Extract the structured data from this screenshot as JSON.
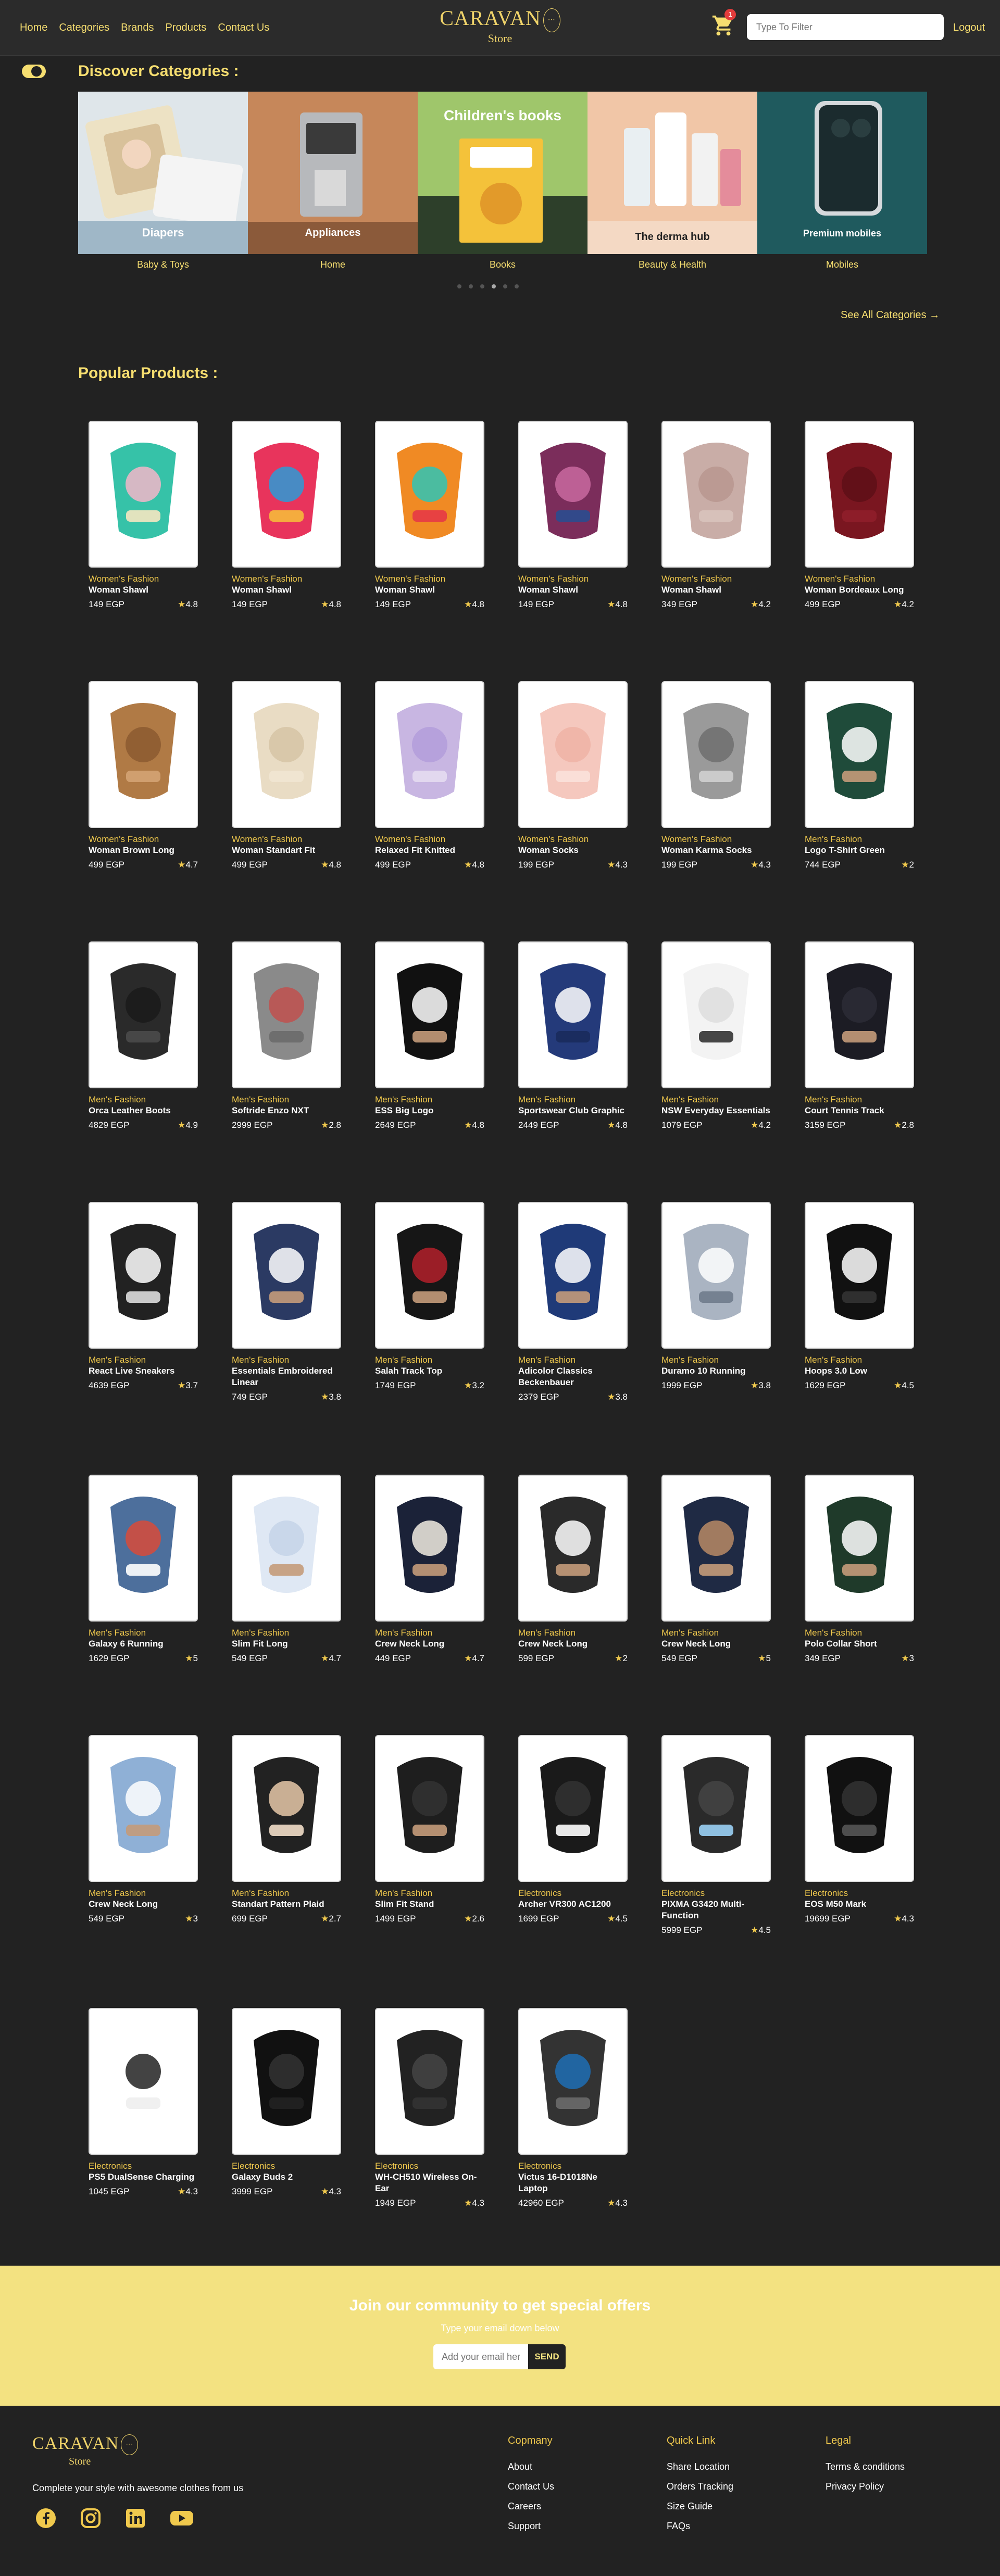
{
  "nav": {
    "links": [
      "Home",
      "Categories",
      "Brands",
      "Products",
      "Contact Us"
    ],
    "logo_word": "CARAVAN",
    "logo_sub": "Store",
    "cart_count": "1",
    "search_placeholder": "Type To Filter",
    "logout": "Logout"
  },
  "categories": {
    "title": "Discover Categories :",
    "items": [
      {
        "label": "Baby & Toys",
        "caption": "Diapers"
      },
      {
        "label": "Home",
        "caption": "Appliances"
      },
      {
        "label": "Books",
        "caption": "Children's books"
      },
      {
        "label": "Beauty & Health",
        "caption": "The derma hub"
      },
      {
        "label": "Mobiles",
        "caption": "Premium mobiles"
      }
    ],
    "see_all": "See All Categories →"
  },
  "products": {
    "title": "Popular Products :",
    "items": [
      {
        "category": "Women's Fashion",
        "name": "Woman Shawl",
        "price": "149 EGP",
        "rating": "4.8"
      },
      {
        "category": "Women's Fashion",
        "name": "Woman Shawl",
        "price": "149 EGP",
        "rating": "4.8"
      },
      {
        "category": "Women's Fashion",
        "name": "Woman Shawl",
        "price": "149 EGP",
        "rating": "4.8"
      },
      {
        "category": "Women's Fashion",
        "name": "Woman Shawl",
        "price": "149 EGP",
        "rating": "4.8"
      },
      {
        "category": "Women's Fashion",
        "name": "Woman Shawl",
        "price": "349 EGP",
        "rating": "4.2"
      },
      {
        "category": "Women's Fashion",
        "name": "Woman Bordeaux Long",
        "price": "499 EGP",
        "rating": "4.2"
      },
      {
        "category": "Women's Fashion",
        "name": "Woman Brown Long",
        "price": "499 EGP",
        "rating": "4.7"
      },
      {
        "category": "Women's Fashion",
        "name": "Woman Standart Fit",
        "price": "499 EGP",
        "rating": "4.8"
      },
      {
        "category": "Women's Fashion",
        "name": "Relaxed Fit Knitted",
        "price": "499 EGP",
        "rating": "4.8"
      },
      {
        "category": "Women's Fashion",
        "name": "Woman Socks",
        "price": "199 EGP",
        "rating": "4.3"
      },
      {
        "category": "Women's Fashion",
        "name": "Woman Karma Socks",
        "price": "199 EGP",
        "rating": "4.3"
      },
      {
        "category": "Men's Fashion",
        "name": "Logo T-Shirt Green",
        "price": "744 EGP",
        "rating": "2"
      },
      {
        "category": "Men's Fashion",
        "name": "Orca Leather Boots",
        "price": "4829 EGP",
        "rating": "4.9"
      },
      {
        "category": "Men's Fashion",
        "name": "Softride Enzo NXT",
        "price": "2999 EGP",
        "rating": "2.8"
      },
      {
        "category": "Men's Fashion",
        "name": "ESS Big Logo",
        "price": "2649 EGP",
        "rating": "4.8"
      },
      {
        "category": "Men's Fashion",
        "name": "Sportswear Club Graphic",
        "price": "2449 EGP",
        "rating": "4.8"
      },
      {
        "category": "Men's Fashion",
        "name": "NSW Everyday Essentials",
        "price": "1079 EGP",
        "rating": "4.2"
      },
      {
        "category": "Men's Fashion",
        "name": "Court Tennis Track",
        "price": "3159 EGP",
        "rating": "2.8"
      },
      {
        "category": "Men's Fashion",
        "name": "React Live Sneakers",
        "price": "4639 EGP",
        "rating": "3.7"
      },
      {
        "category": "Men's Fashion",
        "name": "Essentials Embroidered Linear",
        "price": "749 EGP",
        "rating": "3.8"
      },
      {
        "category": "Men's Fashion",
        "name": "Salah Track Top",
        "price": "1749 EGP",
        "rating": "3.2"
      },
      {
        "category": "Men's Fashion",
        "name": "Adicolor Classics Beckenbauer",
        "price": "2379 EGP",
        "rating": "3.8"
      },
      {
        "category": "Men's Fashion",
        "name": "Duramo 10 Running",
        "price": "1999 EGP",
        "rating": "3.8"
      },
      {
        "category": "Men's Fashion",
        "name": "Hoops 3.0 Low",
        "price": "1629 EGP",
        "rating": "4.5"
      },
      {
        "category": "Men's Fashion",
        "name": "Galaxy 6 Running",
        "price": "1629 EGP",
        "rating": "5"
      },
      {
        "category": "Men's Fashion",
        "name": "Slim Fit Long",
        "price": "549 EGP",
        "rating": "4.7"
      },
      {
        "category": "Men's Fashion",
        "name": "Crew Neck Long",
        "price": "449 EGP",
        "rating": "4.7"
      },
      {
        "category": "Men's Fashion",
        "name": "Crew Neck Long",
        "price": "599 EGP",
        "rating": "2"
      },
      {
        "category": "Men's Fashion",
        "name": "Crew Neck Long",
        "price": "549 EGP",
        "rating": "5"
      },
      {
        "category": "Men's Fashion",
        "name": "Polo Collar Short",
        "price": "349 EGP",
        "rating": "3"
      },
      {
        "category": "Men's Fashion",
        "name": "Crew Neck Long",
        "price": "549 EGP",
        "rating": "3"
      },
      {
        "category": "Men's Fashion",
        "name": "Standart Pattern Plaid",
        "price": "699 EGP",
        "rating": "2.7"
      },
      {
        "category": "Men's Fashion",
        "name": "Slim Fit Stand",
        "price": "1499 EGP",
        "rating": "2.6"
      },
      {
        "category": "Electronics",
        "name": "Archer VR300 AC1200",
        "price": "1699 EGP",
        "rating": "4.5"
      },
      {
        "category": "Electronics",
        "name": "PIXMA G3420 Multi-Function",
        "price": "5999 EGP",
        "rating": "4.5"
      },
      {
        "category": "Electronics",
        "name": "EOS M50 Mark",
        "price": "19699 EGP",
        "rating": "4.3"
      },
      {
        "category": "Electronics",
        "name": "PS5 DualSense Charging",
        "price": "1045 EGP",
        "rating": "4.3"
      },
      {
        "category": "Electronics",
        "name": "Galaxy Buds 2",
        "price": "3999 EGP",
        "rating": "4.3"
      },
      {
        "category": "Electronics",
        "name": "WH-CH510 Wireless On-Ear",
        "price": "1949 EGP",
        "rating": "4.3"
      },
      {
        "category": "Electronics",
        "name": "Victus 16-D1018Ne Laptop",
        "price": "42960 EGP",
        "rating": "4.3"
      }
    ]
  },
  "newsletter": {
    "title": "Join our community to get special offers",
    "subtitle": "Type your email down below",
    "placeholder": "Add your email here",
    "button": "SEND"
  },
  "footer": {
    "tagline": "Complete your style with awesome clothes from us",
    "columns": [
      {
        "heading": "Copmany",
        "links": [
          "About",
          "Contact Us",
          "Careers",
          "Support"
        ]
      },
      {
        "heading": "Quick Link",
        "links": [
          "Share Location",
          "Orders Tracking",
          "Size Guide",
          "FAQs"
        ]
      },
      {
        "heading": "Legal",
        "links": [
          "Terms & conditions",
          "Privacy Policy"
        ]
      }
    ]
  },
  "colors": {
    "accent": "#f6de70",
    "background": "#222222",
    "newsletter": "#f3e281"
  }
}
